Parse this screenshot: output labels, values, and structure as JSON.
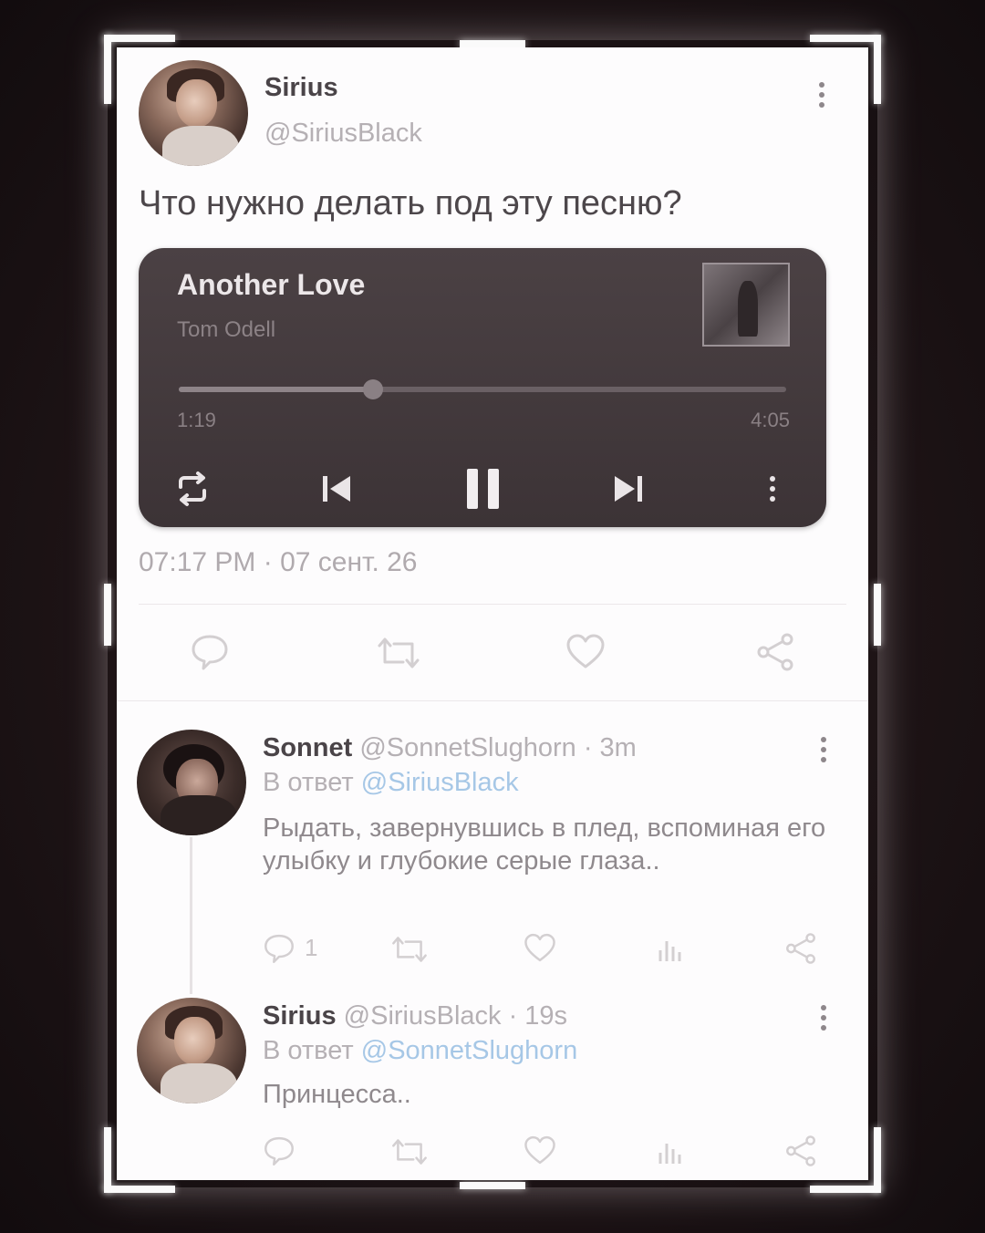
{
  "tweet": {
    "author_name": "Sirius",
    "author_handle": "@SiriusBlack",
    "text": "Что нужно делать под эту песню?",
    "timestamp": "07:17 PM · 07 сент. 26",
    "player": {
      "song": "Another Love",
      "artist": "Tom Odell",
      "current_time": "1:19",
      "total_time": "4:05",
      "progress": 0.32
    },
    "actions": [
      "reply-icon",
      "retweet-icon",
      "like-icon",
      "share-icon"
    ]
  },
  "replies": [
    {
      "name": "Sonnet",
      "handle_time": "@SonnetSlughorn · 3m",
      "reply_to_prefix": "В ответ",
      "reply_to": "@SiriusBlack",
      "text": "Рыдать, завернувшись в плед, вспоминая его улыбку и глубокие серые глаза..",
      "reply_count": "1"
    },
    {
      "name": "Sirius",
      "handle_time": "@SiriusBlack · 19s",
      "reply_to_prefix": "В ответ",
      "reply_to": "@SonnetSlughorn",
      "text": "Принцесса.."
    }
  ],
  "colors": {
    "card": "#fdfcfd",
    "player": "#3f3538",
    "mention": "#a6c7e6",
    "background": "#1e1416"
  }
}
